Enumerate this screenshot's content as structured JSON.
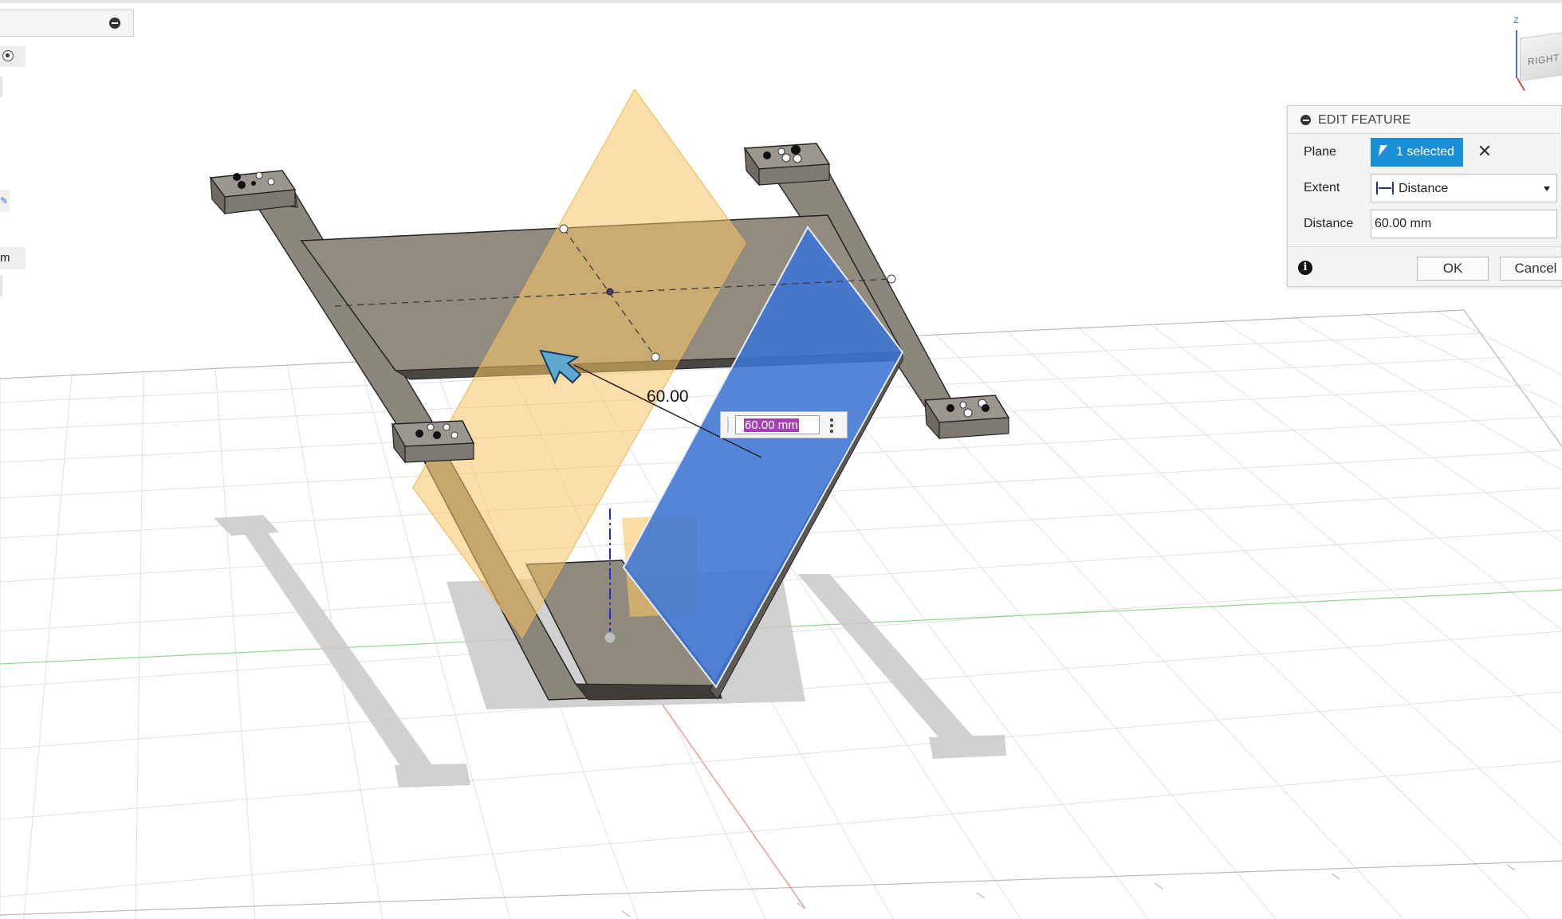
{
  "left_panel": {
    "unit_suffix": "m"
  },
  "view_cube": {
    "face_label": "RIGHT",
    "axis_label": "Z"
  },
  "edit_feature": {
    "title": "EDIT FEATURE",
    "plane_label": "Plane",
    "plane_value": "1 selected",
    "extent_label": "Extent",
    "extent_value": "Distance",
    "distance_label": "Distance",
    "distance_value": "60.00 mm",
    "ok_label": "OK",
    "cancel_label": "Cancel"
  },
  "canvas": {
    "dimension_input_value": "60.00 mm",
    "dimension_label": "60.00"
  },
  "colors": {
    "selected_blue": "#1a8fd6",
    "plane_orange": "#f8c565",
    "face_blue": "#3c74d4",
    "body_gray": "#908a7f",
    "highlight_purple": "#a63fb6"
  }
}
